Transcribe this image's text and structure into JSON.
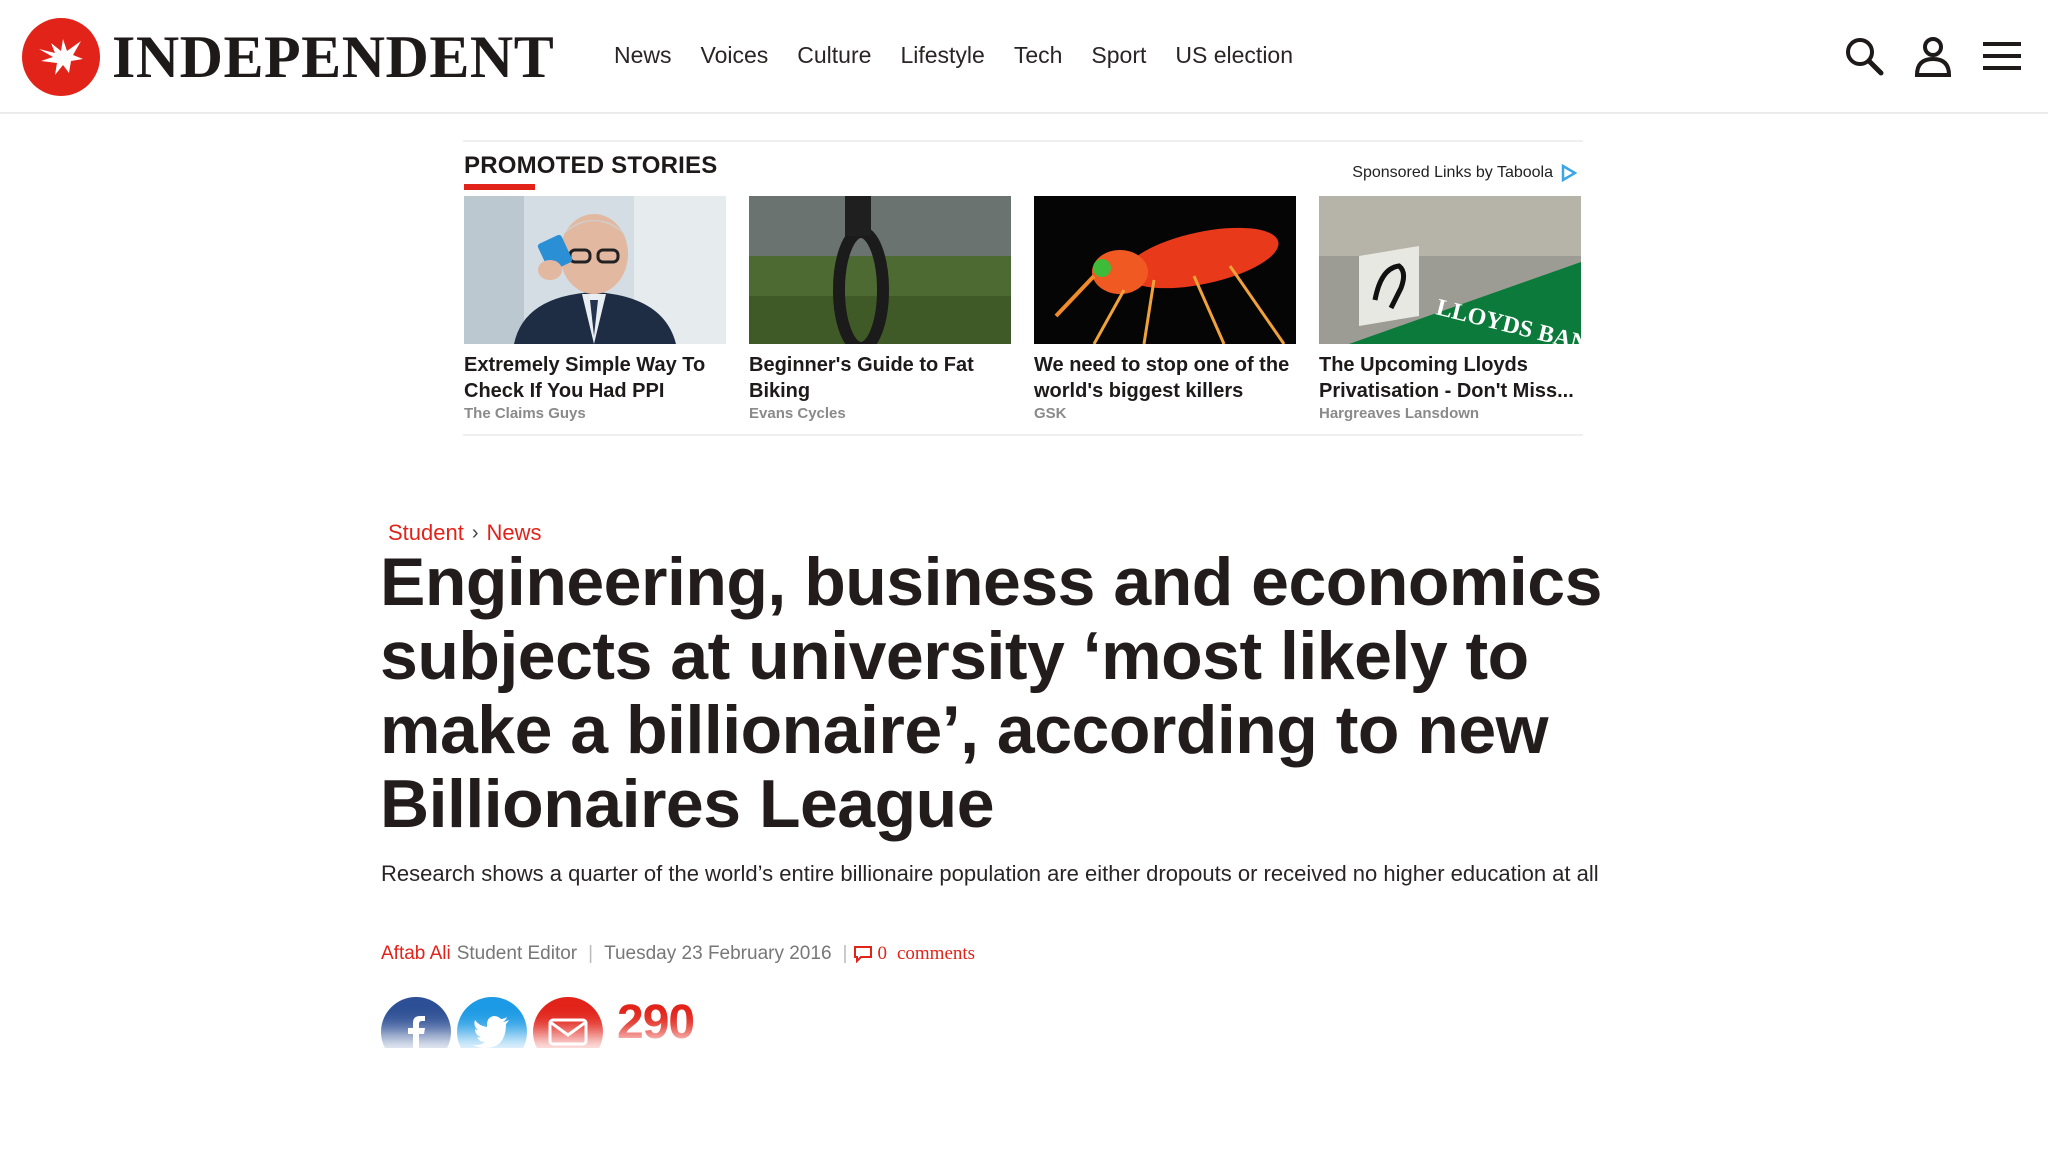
{
  "header": {
    "logo_text": "INDEPENDENT",
    "nav": [
      "News",
      "Voices",
      "Culture",
      "Lifestyle",
      "Tech",
      "Sport",
      "US election"
    ]
  },
  "promo": {
    "title": "PROMOTED STORIES",
    "sponsor": "Sponsored Links by Taboola",
    "cards": [
      {
        "title": "Extremely Simple Way To Check If You Had PPI",
        "source": "The Claims Guys"
      },
      {
        "title": "Beginner's Guide to Fat Biking",
        "source": "Evans Cycles"
      },
      {
        "title": "We need to stop one of the world's biggest killers",
        "source": "GSK"
      },
      {
        "title": "The Upcoming Lloyds Privatisation - Don't Miss...",
        "source": "Hargreaves Lansdown",
        "image_text": "LLOYDS BANK"
      }
    ]
  },
  "article": {
    "breadcrumb": [
      "Student",
      "News"
    ],
    "breadcrumb_sep": "›",
    "headline": "Engineering, business and economics subjects at university ‘most likely to make a billionaire’, according to new Billionaires League",
    "standfirst": "Research shows a quarter of the world’s entire billionaire population are either dropouts or received no higher education at all",
    "author": "Aftab Ali",
    "role": "Student Editor",
    "date": "Tuesday 23 February 2016",
    "comments_count": "0",
    "comments_label": "comments",
    "share_count": "290"
  },
  "colors": {
    "brand_red": "#e2231a",
    "facebook": "#2d4f95",
    "twitter": "#1c9ae5"
  },
  "icons": [
    "eagle-logo-icon",
    "search-icon",
    "account-icon",
    "menu-icon",
    "taboola-icon",
    "comment-icon",
    "facebook-icon",
    "twitter-icon",
    "email-icon"
  ]
}
